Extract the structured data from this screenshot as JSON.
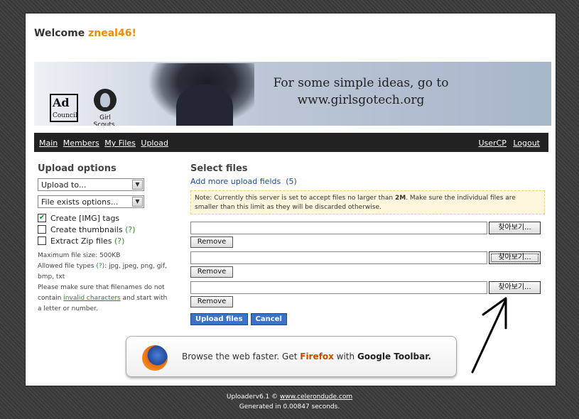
{
  "welcome": {
    "prefix": "Welcome",
    "username": "zneal46!"
  },
  "banner": {
    "adcouncil_top": "Ad",
    "adcouncil_bottom": "Council",
    "girlscouts_label": "Girl Scouts.",
    "tagline_line1": "For some simple ideas, go to",
    "tagline_line2": "www.girlsgotech.org"
  },
  "nav": {
    "left": [
      "Main",
      "Members",
      "My Files",
      "Upload"
    ],
    "right": [
      "UserCP",
      "Logout"
    ]
  },
  "sidebar": {
    "title": "Upload options",
    "upload_to": "Upload to...",
    "file_exists": "File exists options...",
    "options": [
      {
        "label": "Create [IMG] tags",
        "checked": "✔",
        "help": ""
      },
      {
        "label": "Create thumbnails",
        "checked": "",
        "help": "(?)"
      },
      {
        "label": "Extract Zip files",
        "checked": "",
        "help": "(?)"
      }
    ],
    "max_size": "Maximum file size: 500KB",
    "allowed_prefix": "Allowed file types",
    "allowed_help": "(?)",
    "allowed_types": ": jpg, jpeg, png, gif, bmp, txt",
    "filenames_prefix": "Please make sure that filenames do not contain",
    "invalid_link": "invalid characters",
    "filenames_suffix": "and start with a letter or number."
  },
  "main": {
    "title": "Select files",
    "add_more": "Add more upload fields",
    "add_more_count": "(5)",
    "note_prefix": "Note: Currently this server is set to accept files no larger than",
    "note_size": "2M",
    "note_suffix": ". Make sure the individual files are smaller than this limit as they will be discarded otherwise.",
    "files": [
      {
        "browse": "찾아보기...",
        "remove": "Remove"
      },
      {
        "browse": "찾아보기...",
        "remove": "Remove"
      },
      {
        "browse": "찾아보기...",
        "remove": "Remove"
      }
    ],
    "upload_btn": "Upload files",
    "cancel_btn": "Cancel"
  },
  "toolbar_ad": {
    "prefix": "Browse the web faster. Get",
    "firefox": "Firefox",
    "with": "with",
    "google": "Google Toolbar."
  },
  "footer": {
    "version": "Uploaderv6.1 ©",
    "site": "www.celerondude.com",
    "generated": "Generated in 0.00847 seconds."
  },
  "icons": {
    "firefox": "firefox-icon",
    "dropdown": "chevron-down-icon",
    "annotation": "arrow-annotation"
  }
}
